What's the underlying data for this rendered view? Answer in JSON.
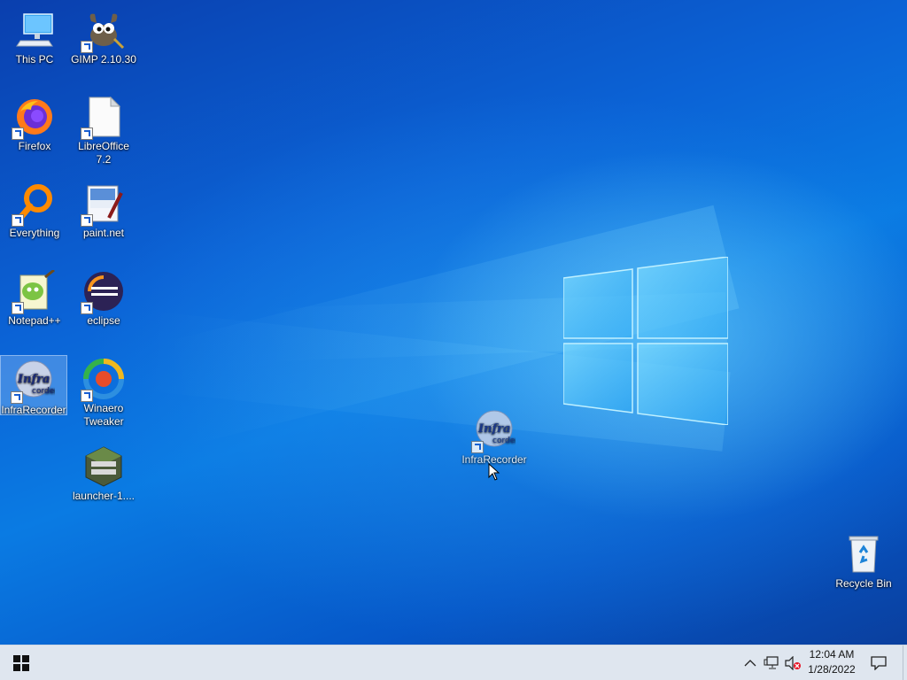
{
  "desktop": {
    "icons": [
      {
        "label": "This PC"
      },
      {
        "label": "GIMP 2.10.30"
      },
      {
        "label": "Firefox"
      },
      {
        "label": "LibreOffice 7.2"
      },
      {
        "label": "Everything"
      },
      {
        "label": "paint.net"
      },
      {
        "label": "Notepad++"
      },
      {
        "label": "eclipse"
      },
      {
        "label": "InfraRecorder"
      },
      {
        "label": "Winaero Tweaker"
      },
      {
        "label": "launcher-1...."
      },
      {
        "label": "Recycle Bin"
      }
    ],
    "dragged_icon": {
      "label": "InfraRecorder"
    }
  },
  "taskbar": {
    "start_icon": "windows-logo-icon",
    "tray_icons": [
      "chevron-up-icon",
      "network-icon",
      "volume-muted-icon"
    ],
    "clock": {
      "time": "12:04 AM",
      "date": "1/28/2022"
    },
    "notification_icon": "action-center-icon"
  },
  "colors": {
    "desktop_blue": "#0a6fdf",
    "taskbar_bg": "#dfe6ef",
    "selection": "#c8e1ff"
  }
}
